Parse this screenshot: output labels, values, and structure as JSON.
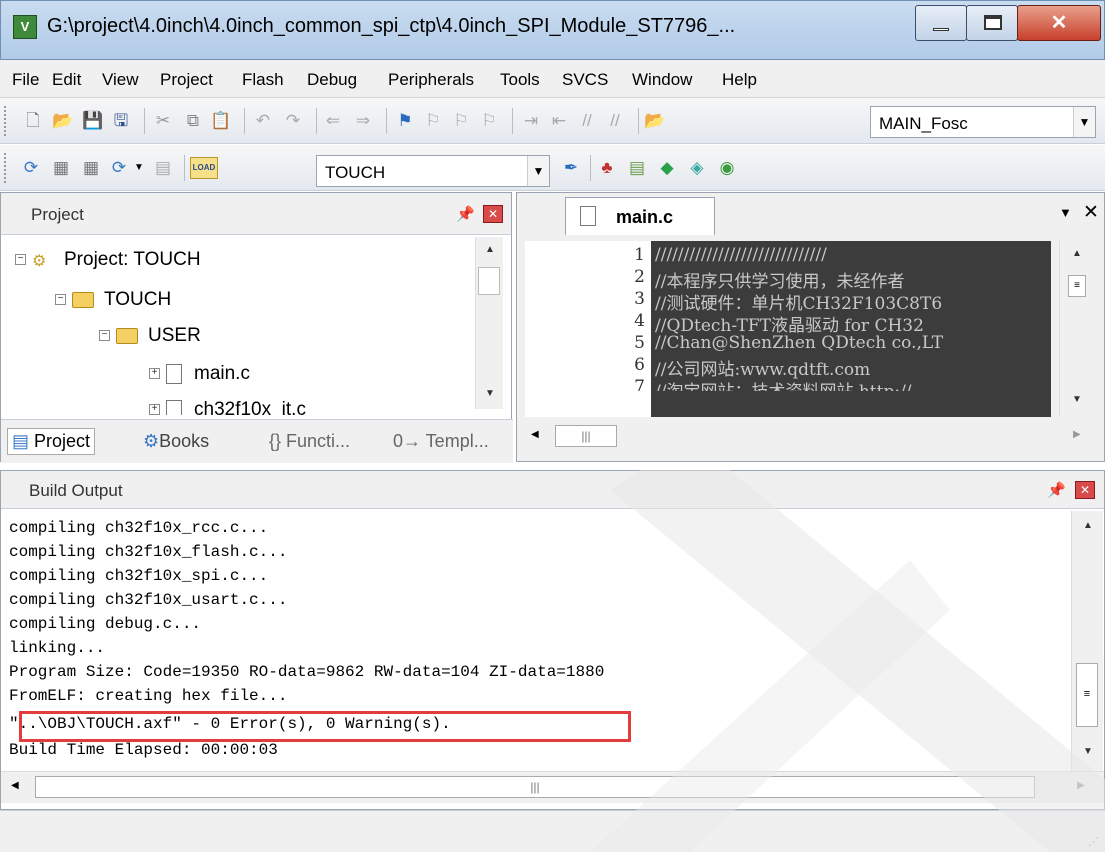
{
  "window": {
    "title": "G:\\project\\4.0inch\\4.0inch_common_spi_ctp\\4.0inch_SPI_Module_ST7796_...",
    "app_icon_text": "V"
  },
  "menu": [
    "File",
    "Edit",
    "View",
    "Project",
    "Flash",
    "Debug",
    "Peripherals",
    "Tools",
    "SVCS",
    "Window",
    "Help"
  ],
  "toolbar1": {
    "combo_value": "MAIN_Fosc"
  },
  "toolbar2": {
    "target_value": "TOUCH",
    "load_label": "LOAD"
  },
  "project_pane": {
    "title": "Project",
    "tree": [
      {
        "label": "Project: TOUCH",
        "type": "project"
      },
      {
        "label": "TOUCH",
        "type": "folder"
      },
      {
        "label": "USER",
        "type": "folder"
      },
      {
        "label": "main.c",
        "type": "file"
      },
      {
        "label": "ch32f10x_it.c",
        "type": "file"
      }
    ],
    "tabs": [
      "Project",
      "Books",
      "{} Functi...",
      "0→ Templ..."
    ]
  },
  "editor": {
    "tab": "main.c",
    "line_numbers": [
      "1",
      "2",
      "3",
      "4",
      "5",
      "6",
      "7"
    ],
    "lines": [
      "//////////////////////////////",
      "//本程序只供学习使用，未经作者",
      "//测试硬件：单片机CH32F103C8T6",
      "//QDtech-TFT液晶驱动 for CH32",
      "//Chan@ShenZhen QDtech co.,LT",
      "//公司网站:www.qdtft.com",
      "//淘宝网站：技术资料网站 http://"
    ]
  },
  "build": {
    "title": "Build Output",
    "lines": [
      "compiling ch32f10x_rcc.c...",
      "compiling ch32f10x_flash.c...",
      "compiling ch32f10x_spi.c...",
      "compiling ch32f10x_usart.c...",
      "compiling debug.c...",
      "linking...",
      "Program Size: Code=19350 RO-data=9862 RW-data=104 ZI-data=1880",
      "FromELF: creating hex file...",
      "\"..\\OBJ\\TOUCH.axf\" - 0 Error(s), 0 Warning(s).",
      "Build Time Elapsed:  00:00:03"
    ]
  },
  "colors": {
    "highlight": "#e23c3c",
    "code_bg": "#3c3c3c"
  }
}
